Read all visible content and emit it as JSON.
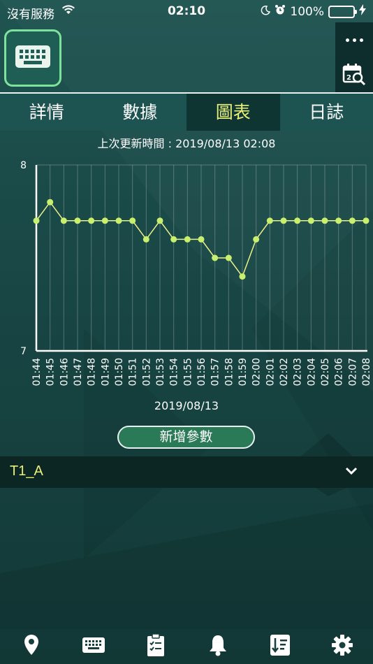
{
  "status": {
    "carrier": "沒有服務",
    "time": "02:10",
    "battery": "100%"
  },
  "header": {
    "badge_icon": "keyboard-icon",
    "more_icon": "more-icon",
    "calendar_icon": "calendar-search-icon"
  },
  "tabs": [
    {
      "label": "詳情",
      "active": false
    },
    {
      "label": "數據",
      "active": false
    },
    {
      "label": "圖表",
      "active": true
    },
    {
      "label": "日誌",
      "active": false
    }
  ],
  "last_updated": "上次更新時間 : 2019/08/13 02:08",
  "chart_data": {
    "type": "line",
    "x": [
      "01:44",
      "01:45",
      "01:46",
      "01:47",
      "01:48",
      "01:49",
      "01:50",
      "01:51",
      "01:52",
      "01:53",
      "01:54",
      "01:55",
      "01:56",
      "01:57",
      "01:58",
      "01:59",
      "02:00",
      "02:01",
      "02:02",
      "02:03",
      "02:04",
      "02:05",
      "02:06",
      "02:07",
      "02:08"
    ],
    "values": [
      7.7,
      7.8,
      7.7,
      7.7,
      7.7,
      7.7,
      7.7,
      7.7,
      7.6,
      7.7,
      7.6,
      7.6,
      7.6,
      7.5,
      7.5,
      7.4,
      7.6,
      7.7,
      7.7,
      7.7,
      7.7,
      7.7,
      7.7,
      7.7,
      7.7
    ],
    "ylim": [
      7,
      8
    ],
    "yticks": [
      "7",
      "8"
    ],
    "xlabel": "2019/08/13",
    "grid": true,
    "line_color": "#eef08a",
    "marker_color": "#c8f06e"
  },
  "add_param_label": "新增參數",
  "param": {
    "name": "T1_A"
  },
  "nav": [
    {
      "icon": "location-pin-icon"
    },
    {
      "icon": "keyboard-icon"
    },
    {
      "icon": "clipboard-checklist-icon"
    },
    {
      "icon": "bell-icon"
    },
    {
      "icon": "sort-list-icon"
    },
    {
      "icon": "gear-icon"
    }
  ]
}
